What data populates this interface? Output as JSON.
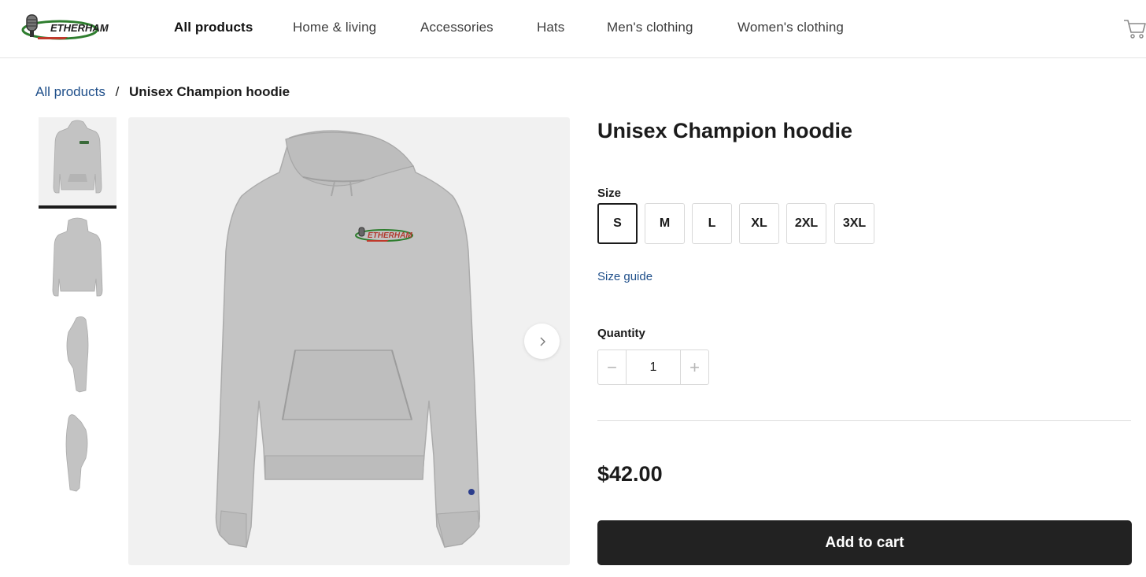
{
  "header": {
    "logo_text": "ETHERHAM",
    "nav": [
      {
        "label": "All products",
        "active": true
      },
      {
        "label": "Home & living",
        "active": false
      },
      {
        "label": "Accessories",
        "active": false
      },
      {
        "label": "Hats",
        "active": false
      },
      {
        "label": "Men's clothing",
        "active": false
      },
      {
        "label": "Women's clothing",
        "active": false
      }
    ],
    "cart_icon": "shopping-cart-icon"
  },
  "breadcrumb": {
    "parent": "All products",
    "separator": "/",
    "current": "Unisex Champion hoodie"
  },
  "gallery": {
    "thumbnails": [
      {
        "view": "front",
        "selected": true
      },
      {
        "view": "back",
        "selected": false
      },
      {
        "view": "left side",
        "selected": false
      },
      {
        "view": "right side",
        "selected": false
      }
    ],
    "main_image_logo_text": "ETHERHAM",
    "next_icon": "chevron-right-icon"
  },
  "product": {
    "title": "Unisex Champion hoodie",
    "size_label": "Size",
    "sizes": [
      "S",
      "M",
      "L",
      "XL",
      "2XL",
      "3XL"
    ],
    "selected_size": "S",
    "size_guide": "Size guide",
    "quantity_label": "Quantity",
    "quantity": "1",
    "minus_symbol": "−",
    "plus_symbol": "+",
    "price": "$42.00",
    "add_to_cart": "Add to cart"
  },
  "colors": {
    "link": "#1f4f8a",
    "button": "#222222",
    "hoodie": "#c3c3c3",
    "image_bg": "#f1f1f1"
  }
}
